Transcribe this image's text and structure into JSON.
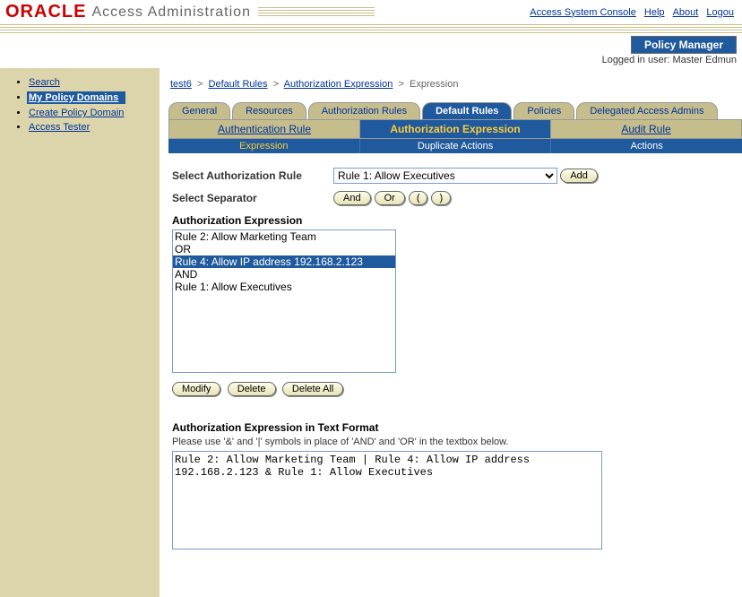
{
  "brand": {
    "name": "ORACLE",
    "sub": "Access Administration"
  },
  "top_links": {
    "console": "Access System Console",
    "help": "Help",
    "about": "About",
    "logout": "Logou"
  },
  "policy_manager_label": "Policy Manager",
  "logged_in": "Logged in user: Master Edmun",
  "sidebar": {
    "items": [
      {
        "label": "Search"
      },
      {
        "label": "My Policy Domains",
        "selected": true
      },
      {
        "label": "Create Policy Domain"
      },
      {
        "label": "Access Tester"
      }
    ]
  },
  "breadcrumb": {
    "a": "test6",
    "b": "Default Rules",
    "c": "Authorization Expression",
    "d": "Expression",
    "sep": ">"
  },
  "tabs": {
    "general": "General",
    "resources": "Resources",
    "auth_rules": "Authorization Rules",
    "default_rules": "Default Rules",
    "policies": "Policies",
    "dele": "Delegated Access Admins"
  },
  "subtabs": {
    "authn": "Authentication Rule",
    "authz": "Authorization Expression",
    "audit": "Audit Rule"
  },
  "crumbs2": {
    "expression": "Expression",
    "dup": "Duplicate Actions",
    "actions": "Actions"
  },
  "form": {
    "select_rule_label": "Select Authorization Rule",
    "select_rule_value": "Rule 1: Allow Executives",
    "add": "Add",
    "select_sep_label": "Select Separator",
    "sep_and": "And",
    "sep_or": "Or",
    "sep_openp": "(",
    "sep_closep": ")",
    "expr_label": "Authorization Expression",
    "listbox": [
      {
        "t": "Rule 2: Allow Marketing Team"
      },
      {
        "t": "OR"
      },
      {
        "t": "Rule 4: Allow IP address 192.168.2.123",
        "sel": true
      },
      {
        "t": "AND"
      },
      {
        "t": "Rule 1: Allow Executives"
      }
    ],
    "modify": "Modify",
    "delete": "Delete",
    "delete_all": "Delete All",
    "text_label": "Authorization Expression in Text Format",
    "text_note": "Please use '&' and '|' symbols in place of 'AND' and 'OR' in the textbox below.",
    "text_value": "Rule 2: Allow Marketing Team | Rule 4: Allow IP address 192.168.2.123 & Rule 1: Allow Executives"
  }
}
